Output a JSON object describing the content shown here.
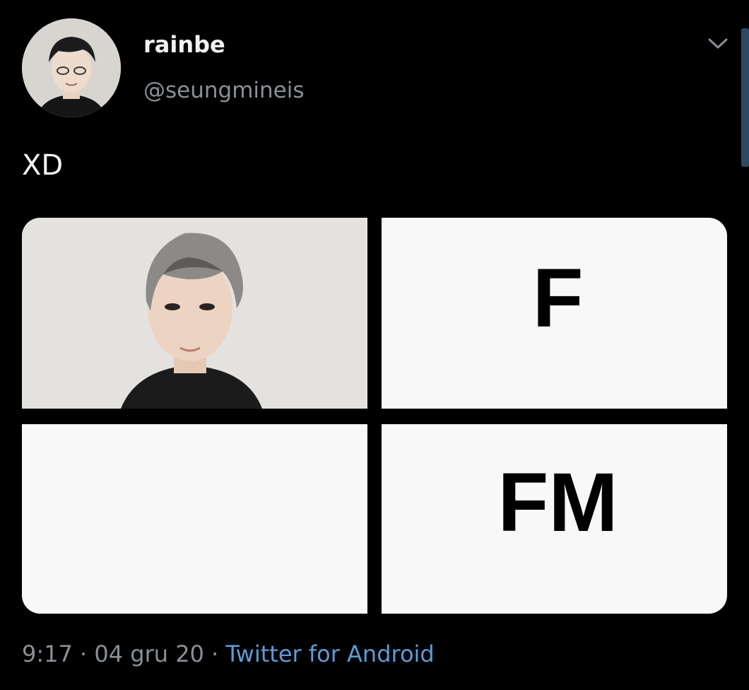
{
  "tweet": {
    "display_name": "rainbe",
    "handle": "@seungmineis",
    "text": "XD",
    "media": {
      "top_right_label": "F",
      "bottom_right_label": "FM"
    },
    "time": "9:17",
    "separator": "·",
    "date": "04 gru 20",
    "source": "Twitter for Android"
  },
  "icons": {
    "menu": "chevron-down-icon",
    "avatar": "avatar-photo"
  },
  "colors": {
    "background": "#000000",
    "secondary_text": "#8a9096",
    "link": "#5e9bd6"
  }
}
